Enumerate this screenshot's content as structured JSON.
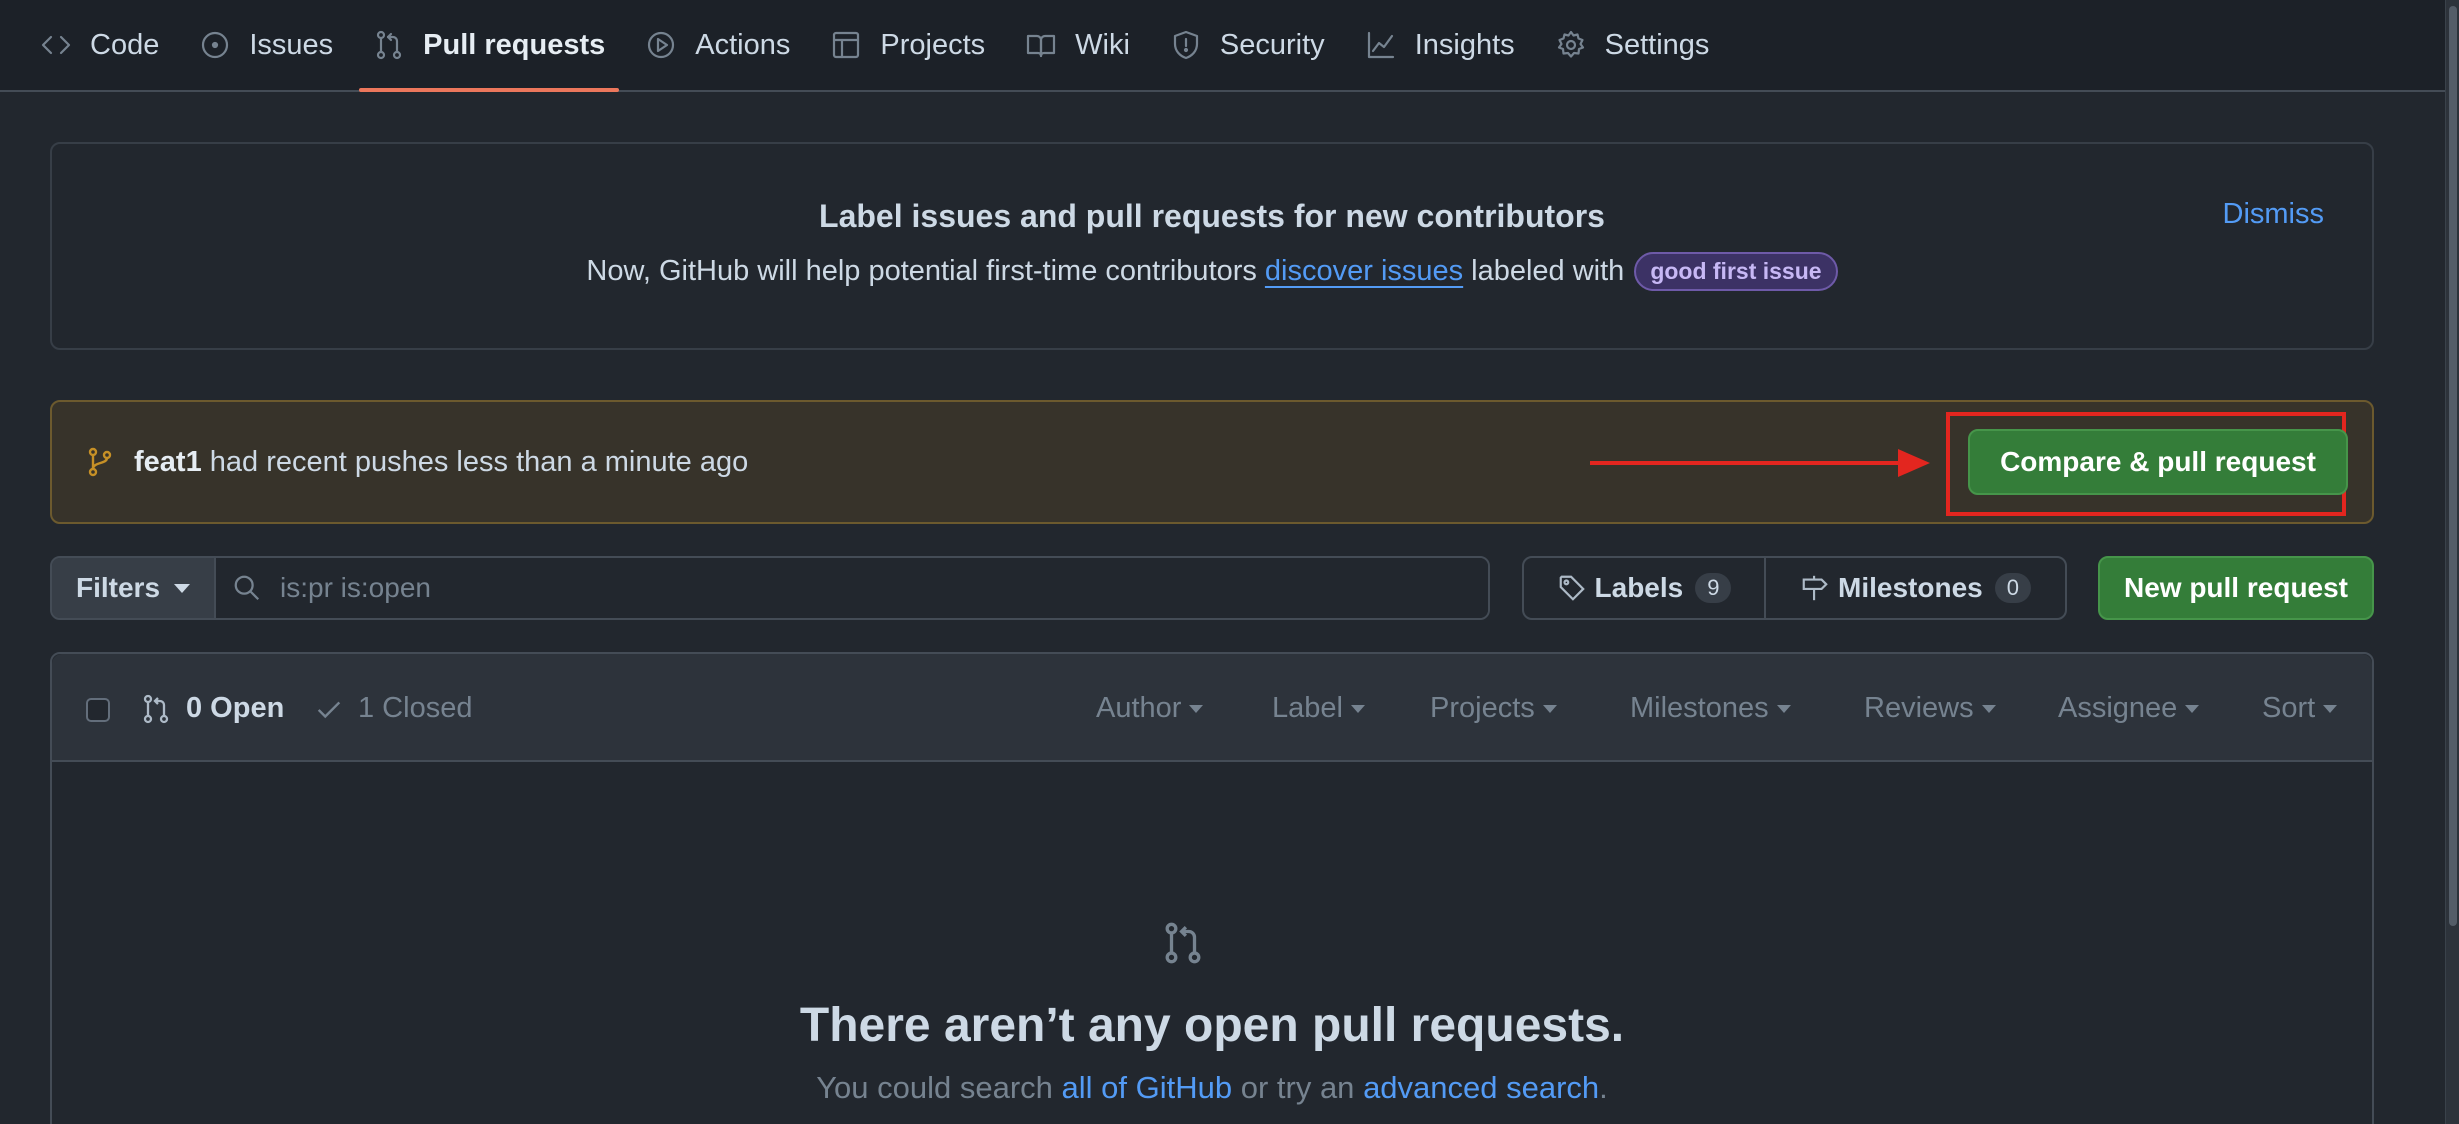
{
  "nav": {
    "tabs": [
      {
        "label": "Code",
        "icon": "code-icon"
      },
      {
        "label": "Issues",
        "icon": "issue-icon"
      },
      {
        "label": "Pull requests",
        "icon": "pull-request-icon",
        "active": true
      },
      {
        "label": "Actions",
        "icon": "play-icon"
      },
      {
        "label": "Projects",
        "icon": "table-icon"
      },
      {
        "label": "Wiki",
        "icon": "book-icon"
      },
      {
        "label": "Security",
        "icon": "shield-icon"
      },
      {
        "label": "Insights",
        "icon": "graph-icon"
      },
      {
        "label": "Settings",
        "icon": "gear-icon"
      }
    ]
  },
  "banner": {
    "title": "Label issues and pull requests for new contributors",
    "text_before": "Now, GitHub will help potential first-time contributors",
    "link": "discover issues",
    "text_after": "labeled with",
    "label_badge": "good first issue",
    "dismiss": "Dismiss"
  },
  "pushes": {
    "branch": "feat1",
    "message": "had recent pushes less than a minute ago",
    "compare_button": "Compare & pull request"
  },
  "filters": {
    "filters_button": "Filters",
    "search_value": "is:pr is:open",
    "labels_label": "Labels",
    "labels_count": "9",
    "milestones_label": "Milestones",
    "milestones_count": "0",
    "new_pr_button": "New pull request"
  },
  "list": {
    "open_label": "0 Open",
    "closed_label": "1 Closed",
    "filter_menus": [
      "Author",
      "Label",
      "Projects",
      "Milestones",
      "Reviews",
      "Assignee",
      "Sort"
    ]
  },
  "empty": {
    "title": "There aren’t any open pull requests.",
    "sub_before": "You could search",
    "link1": "all of GitHub",
    "sub_middle": "or try an",
    "link2": "advanced search",
    "sub_after": "."
  },
  "colors": {
    "accent_tab": "#ec775c",
    "green_button": "#347d39",
    "link": "#539bf5",
    "highlight": "#e3261f"
  }
}
